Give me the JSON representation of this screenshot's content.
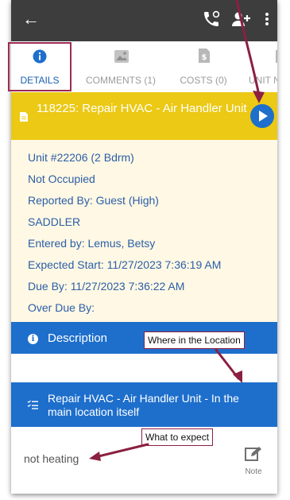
{
  "tabs": [
    {
      "label": "DETAILS",
      "icon": "info-icon",
      "active": true
    },
    {
      "label": "COMMENTS (1)",
      "icon": "image-icon",
      "active": false
    },
    {
      "label": "COSTS (0)",
      "icon": "dollar-document-icon",
      "active": false
    },
    {
      "label": "UNIT NO",
      "icon": "document-icon",
      "active": false
    }
  ],
  "work_order": {
    "title": "118225: Repair HVAC - Air Handler Unit"
  },
  "details": [
    "Unit #22206 (2 Bdrm)",
    "Not Occupied",
    "Reported By: Guest  (High)",
    "SADDLER",
    "Entered by: Lemus, Betsy",
    "Expected Start: 11/27/2023 7:36:19 AM",
    "Due By: 11/27/2023 7:36:22 AM",
    "Over Due By:"
  ],
  "description": {
    "label": "Description"
  },
  "location": {
    "label": "Repair HVAC - Air Handler Unit - In the main location itself"
  },
  "note": {
    "text": "not heating",
    "button_label": "Note"
  },
  "callouts": {
    "location": "Where in the Location",
    "expect": "What to expect"
  },
  "colors": {
    "topbar": "#3d3d3d",
    "header_yellow": "#ebc914",
    "details_bg": "#fff8e4",
    "accent_blue": "#1e6fcc",
    "annotation": "#8b2040"
  }
}
